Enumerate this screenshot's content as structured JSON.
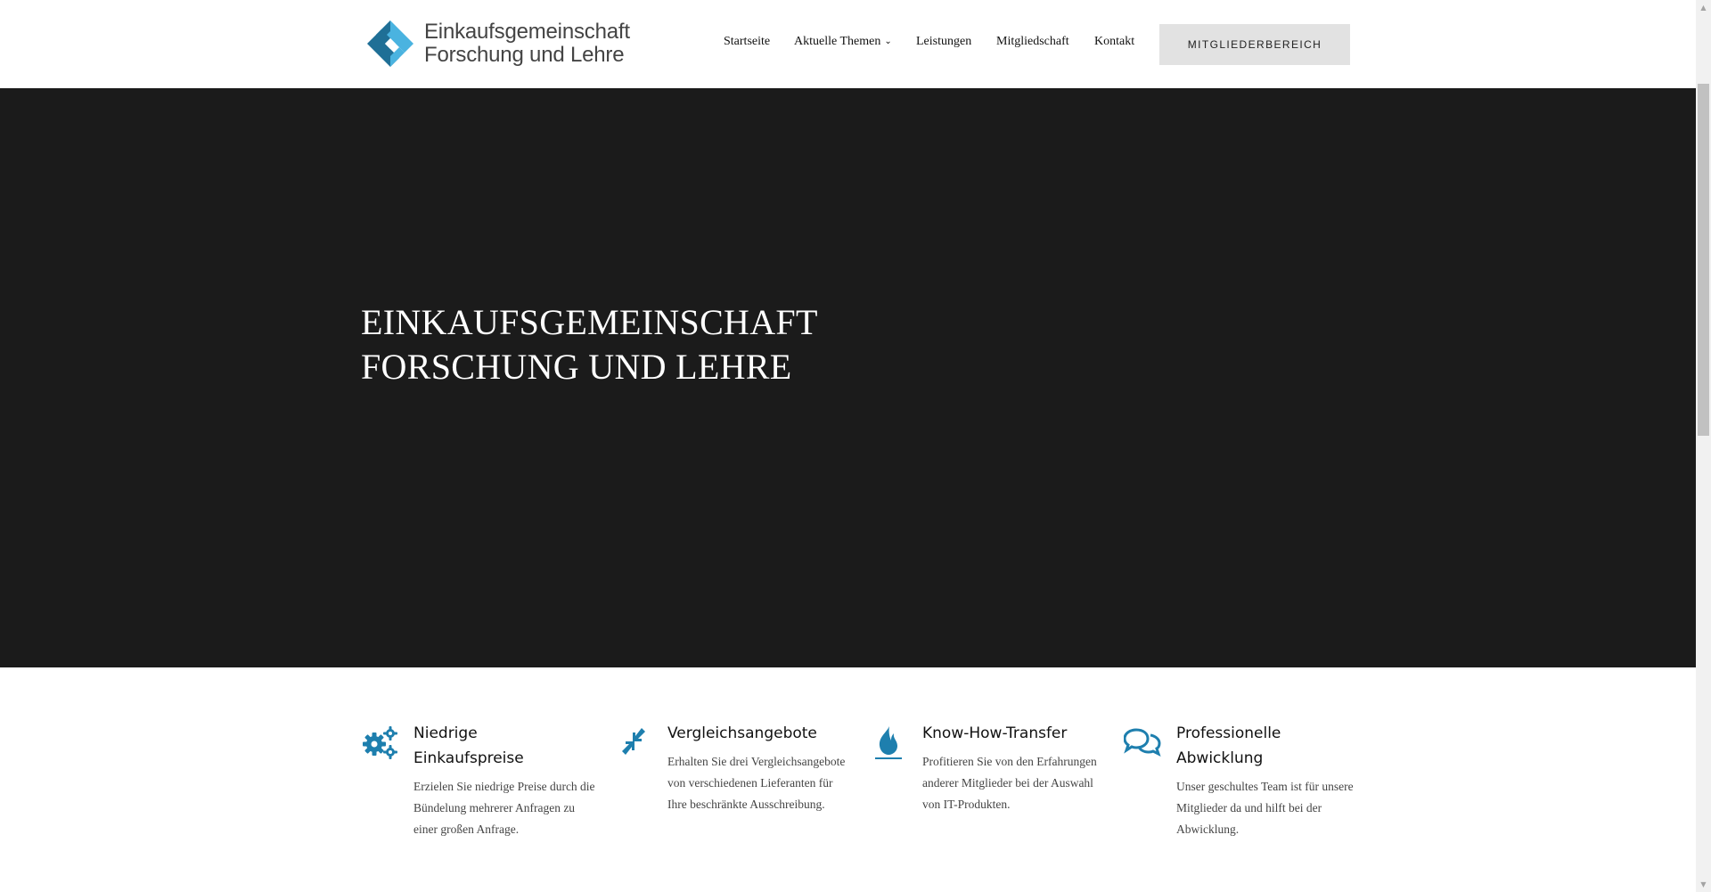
{
  "logo": {
    "line1": "Einkaufsgemeinschaft",
    "line2": "Forschung und Lehre",
    "colors": {
      "dark": "#1f6f96",
      "light": "#4ab3e0"
    }
  },
  "nav": {
    "items": [
      {
        "label": "Startseite"
      },
      {
        "label": "Aktuelle Themen",
        "has_dropdown": true
      },
      {
        "label": "Leistungen"
      },
      {
        "label": "Mitgliedschaft"
      },
      {
        "label": "Kontakt"
      }
    ],
    "member_button": "MITGLIEDERBEREICH"
  },
  "hero": {
    "line1": "EINKAUFSGEMEINSCHAFT",
    "line2": "FORSCHUNG UND LEHRE",
    "background": "#1b1b1b"
  },
  "features": [
    {
      "icon": "gears-icon",
      "title_line1": "Niedrige",
      "title_line2": "Einkaufspreise",
      "text": "Erzielen Sie niedrige Preise durch die Bündelung mehrerer Anfragen zu einer großen Anfrage."
    },
    {
      "icon": "compress-arrows-icon",
      "title_line1": "Vergleichsangebote",
      "title_line2": "",
      "text": "Erhalten Sie drei Vergleichsangebote von verschiedenen Lieferanten für Ihre beschränkte Ausschreibung."
    },
    {
      "icon": "flame-icon",
      "title_line1": "Know-How-Transfer",
      "title_line2": "",
      "text": "Profitieren Sie von den Erfahrungen anderer Mitglieder bei der Auswahl von IT-Produkten."
    },
    {
      "icon": "chat-bubbles-icon",
      "title_line1": "Professionelle",
      "title_line2": "Abwicklung",
      "text": "Unser geschultes Team ist für unsere Mitglieder da und hilft bei der Abwicklung."
    }
  ],
  "accent_color": "#1e7fae"
}
